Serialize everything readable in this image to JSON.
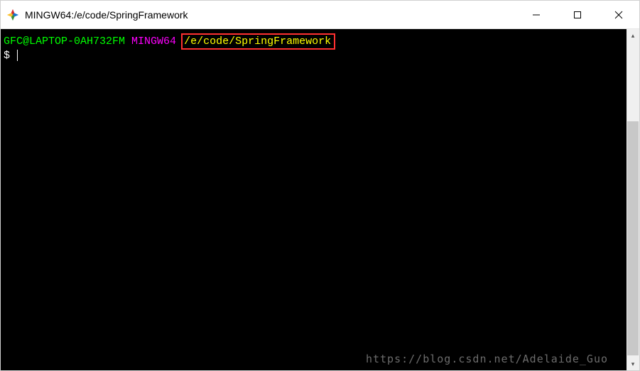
{
  "window": {
    "title": "MINGW64:/e/code/SpringFramework"
  },
  "terminal": {
    "user_host": "GFC@LAPTOP-0AH732FM",
    "msys_label": "MINGW64",
    "path": "/e/code/SpringFramework",
    "prompt": "$"
  },
  "watermark": "https://blog.csdn.net/Adelaide_Guo",
  "scroll": {
    "up": "▴",
    "down": "▾"
  }
}
